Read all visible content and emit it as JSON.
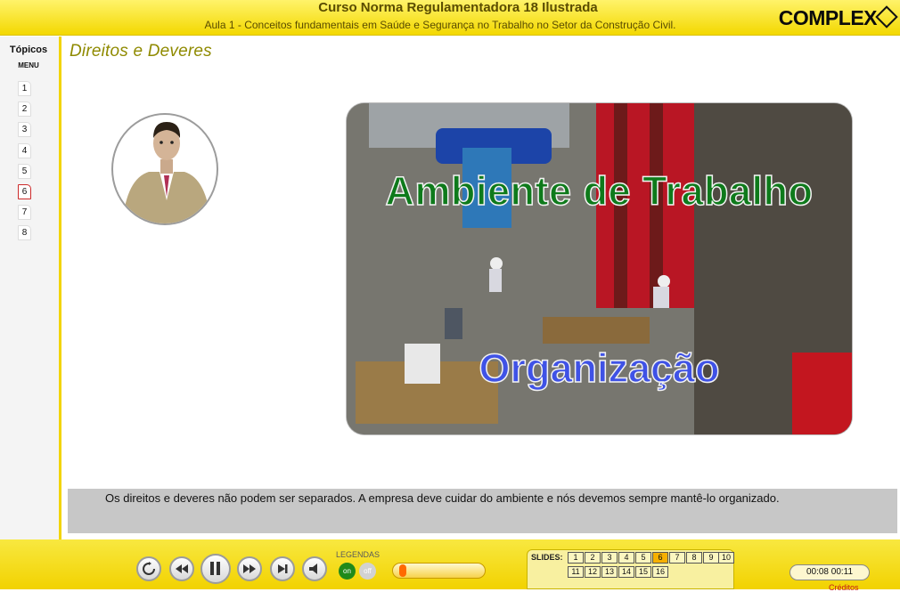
{
  "header": {
    "course_title": "Curso Norma Regulamentadora 18 Ilustrada",
    "lesson_title": "Aula 1 - Conceitos fundamentais em Saúde e Segurança no Trabalho no Setor da Construção Civil.",
    "logo": "COMPLEX"
  },
  "sidebar": {
    "title": "Tópicos",
    "subtitle": "MENU",
    "topics": [
      "1",
      "2",
      "3",
      "4",
      "5",
      "6",
      "7",
      "8"
    ],
    "active_topic": "6"
  },
  "main": {
    "page_title": "Direitos e Deveres",
    "photo_title": "Ambiente de Trabalho",
    "photo_subtitle": "Organização",
    "caption": "Os direitos e deveres não podem ser separados. A empresa deve cuidar do ambiente e nós devemos sempre mantê-lo organizado."
  },
  "player": {
    "controls": [
      "replay-icon",
      "rewind-icon",
      "pause-icon",
      "fast-forward-icon",
      "skip-end-icon",
      "speaker-icon"
    ],
    "legend_label": "LEGENDAS",
    "legend_on": "on",
    "legend_off": "off",
    "volume_level": 0.05,
    "slides_label": "SLIDES:",
    "slides": [
      "1",
      "2",
      "3",
      "4",
      "5",
      "6",
      "7",
      "8",
      "9",
      "10",
      "11",
      "12",
      "13",
      "14",
      "15",
      "16"
    ],
    "current_slide": "6",
    "time_elapsed": "00:08",
    "time_total": "00:11",
    "time_display": "00:08   00:11",
    "credits": "Créditos"
  },
  "colors": {
    "header_yellow": "#f3d800",
    "title_olive": "#8f8a00",
    "photo_title_green": "#0e7a1b",
    "photo_subtitle_blue": "#3f52e6",
    "active_red": "#cc2a2a"
  }
}
